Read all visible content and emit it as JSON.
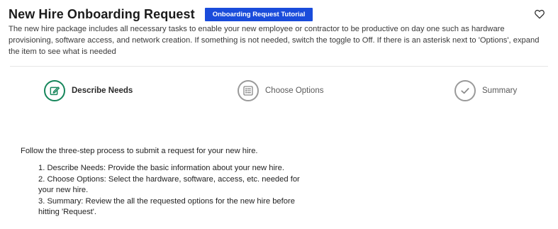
{
  "header": {
    "title": "New Hire Onboarding Request",
    "tutorial_button": "Onboarding Request Tutorial",
    "description": "The new hire package includes all necessary tasks to enable your new employee or contractor to be productive on day one such as hardware provisioning, software access, and network creation. If something is not needed, switch the toggle to Off. If there is an asterisk next to 'Options', expand the item to see what is needed",
    "favorite_icon": "heart-outline-icon"
  },
  "stepper": {
    "steps": [
      {
        "label": "Describe Needs",
        "icon": "edit-icon",
        "state": "active"
      },
      {
        "label": "Choose Options",
        "icon": "list-icon",
        "state": "inactive"
      },
      {
        "label": "Summary",
        "icon": "check-icon",
        "state": "inactive"
      }
    ]
  },
  "content": {
    "intro": "Follow the three-step process to submit a request for your new hire.",
    "items": [
      "1. Describe Needs: Provide the basic information about your new hire.",
      "2. Choose Options: Select the hardware, software, access, etc. needed for your new hire.",
      "3. Summary: Review the all the requested options for the new hire before hitting 'Request'."
    ]
  },
  "colors": {
    "accent_button": "#1a4cdb",
    "active_step": "#16865b",
    "inactive_step": "#9a9a9a"
  }
}
